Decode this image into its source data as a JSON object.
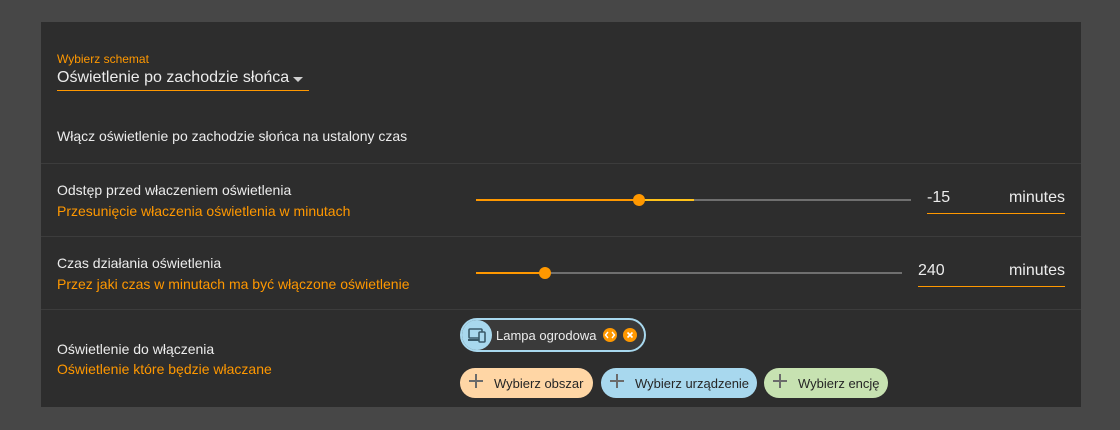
{
  "schema": {
    "label": "Wybierz schemat",
    "value": "Oświetlenie po zachodzie słońca"
  },
  "description": "Włącz oświetlenie po zachodzie słońca na ustalony czas",
  "rows": [
    {
      "title": "Odstęp przed właczeniem oświetlenia",
      "subtitle": "Przesunięcie właczenia oświetlenia w minutach",
      "value": "-15",
      "unit": "minutes",
      "slider_fraction": 0.375
    },
    {
      "title": "Czas działania oświetlenia",
      "subtitle": "Przez jaki czas w minutach ma być włączone oświetlenie",
      "value": "240",
      "unit": "minutes",
      "slider_fraction": 0.163
    }
  ],
  "target": {
    "title": "Oświetlenie do włączenia",
    "subtitle": "Oświetlenie które będzie właczane",
    "chip": {
      "label": "Lampa ogrodowa",
      "icon": "devices-icon"
    },
    "pickers": [
      {
        "label": "Wybierz obszar",
        "color": "#ffd6a5"
      },
      {
        "label": "Wybierz urządzenie",
        "color": "#a8d8ee"
      },
      {
        "label": "Wybierz encję",
        "color": "#c7e2b1"
      }
    ]
  },
  "colors": {
    "accent": "#ff9800",
    "card": "#2d2d2d",
    "background": "#474747"
  }
}
